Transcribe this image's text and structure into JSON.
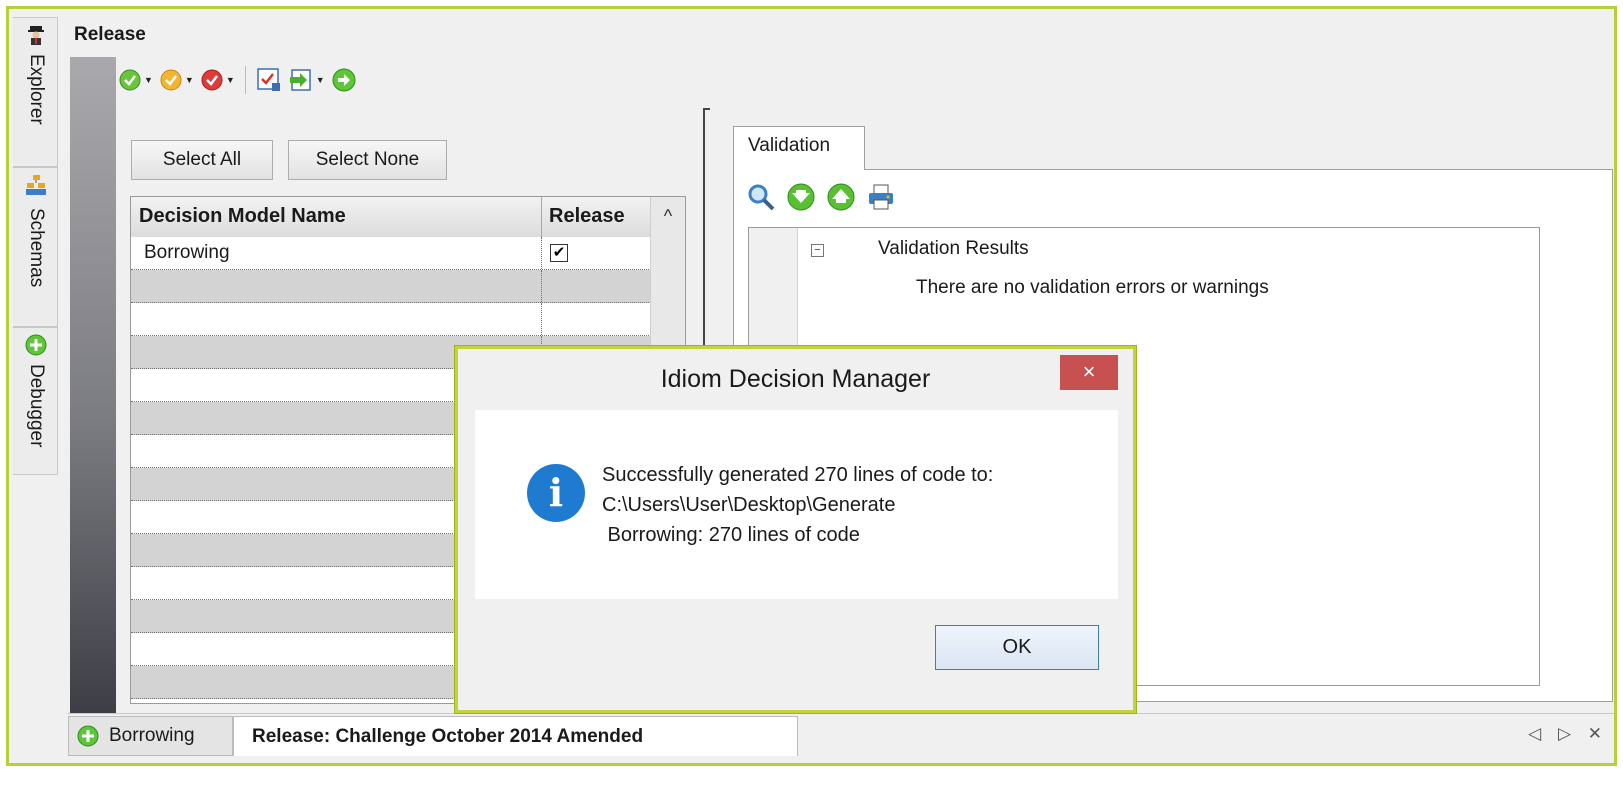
{
  "side_tabs": [
    {
      "label": "Explorer",
      "icon": "agent-icon"
    },
    {
      "label": "Schemas",
      "icon": "xml-schema-icon"
    },
    {
      "label": "Debugger",
      "icon": "green-plus-icon"
    }
  ],
  "release": {
    "title": "Release"
  },
  "toolbar": {
    "items": [
      "green-check-dropdown",
      "orange-check-dropdown",
      "red-check-dropdown",
      "checklist-icon",
      "generate-dropdown",
      "green-arrow-icon"
    ]
  },
  "selection": {
    "select_all": "Select All",
    "select_none": "Select None"
  },
  "grid": {
    "columns": [
      "Decision Model Name",
      "Release"
    ],
    "rows": [
      {
        "name": "Borrowing",
        "release": "✔"
      }
    ],
    "scroll_up": "^"
  },
  "validation": {
    "tab_label": "Validation",
    "tree_toggle": "−",
    "results_title": "Validation Results",
    "message": "There are no validation errors or warnings"
  },
  "bottom_tabs": [
    {
      "label": "Borrowing"
    },
    {
      "label": "Release: Challenge October 2014 Amended"
    }
  ],
  "nav": {
    "arrows": "◁ ▷ ✕"
  },
  "dialog": {
    "title": "Idiom Decision Manager",
    "close": "×",
    "info": "i",
    "line1": "Successfully generated 270 lines of code to:",
    "line2": "C:\\Users\\User\\Desktop\\Generate",
    "line3": " Borrowing: 270 lines of code",
    "ok": "OK"
  },
  "colors": {
    "frame_border": "#b9cf3a",
    "close_red": "#c75050",
    "info_blue": "#1f7bd0"
  }
}
